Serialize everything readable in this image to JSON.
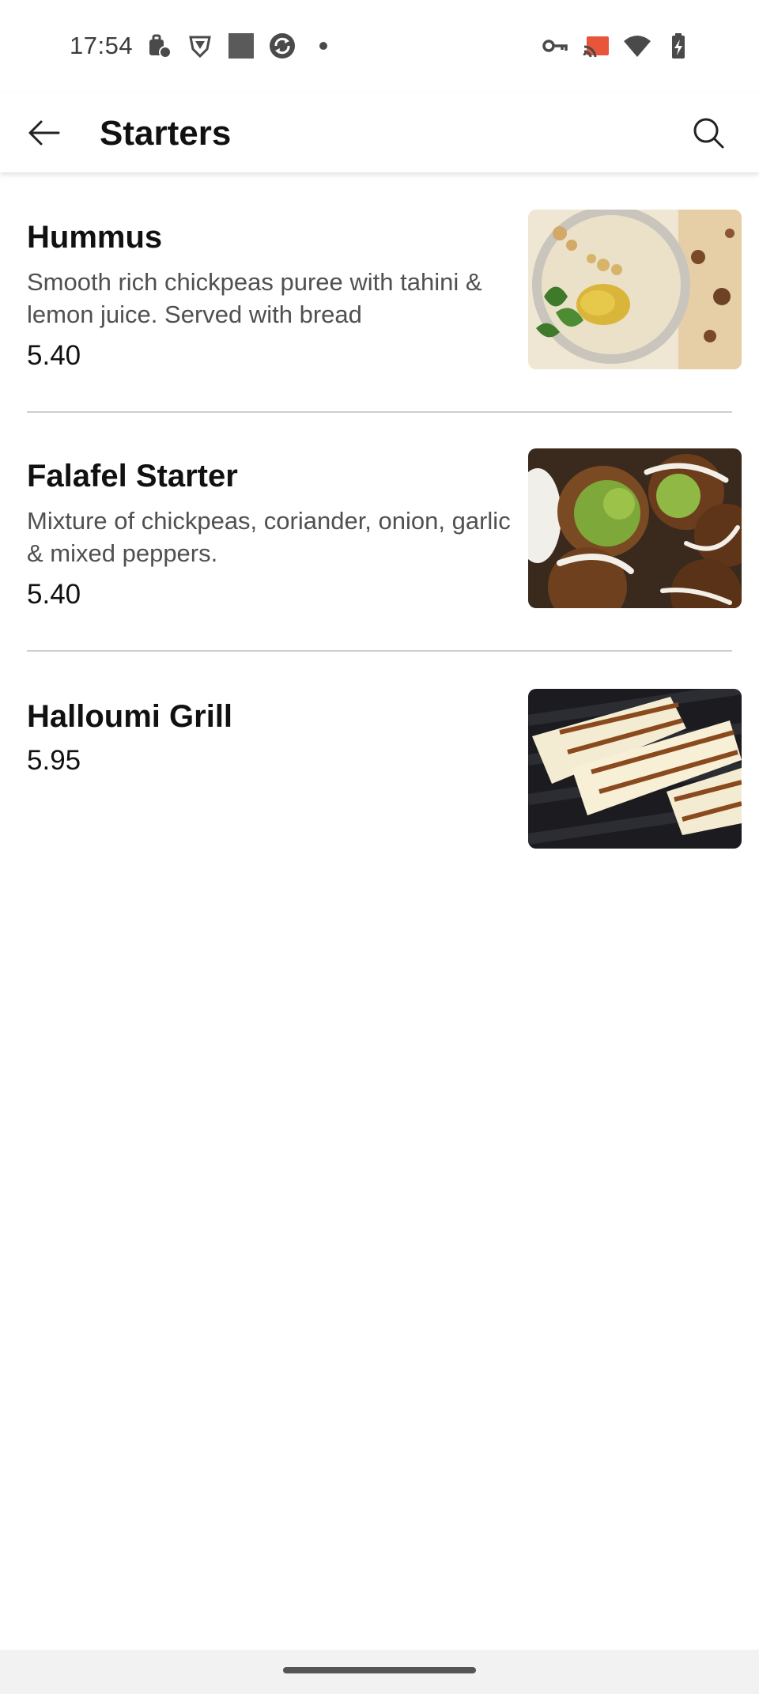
{
  "status_bar": {
    "time": "17:54",
    "left_icons": [
      "work-profile-icon",
      "vpn-shield-icon",
      "square-icon",
      "sync-icon",
      "dot-icon"
    ],
    "right_icons": [
      "key-icon",
      "cast-icon",
      "wifi-icon",
      "battery-charging-icon"
    ],
    "cast_accent": "#e8553a"
  },
  "app_bar": {
    "title": "Starters",
    "back_icon": "arrow-left-icon",
    "search_icon": "search-icon"
  },
  "menu": {
    "items": [
      {
        "name": "Hummus",
        "description": "Smooth rich chickpeas puree with tahini & lemon juice. Served with bread",
        "price": "5.40",
        "image": "hummus-photo"
      },
      {
        "name": "Falafel Starter",
        "description": "Mixture of chickpeas, coriander, onion, garlic & mixed peppers.",
        "price": "5.40",
        "image": "falafel-photo"
      },
      {
        "name": "Halloumi Grill",
        "description": "",
        "price": "5.95",
        "image": "halloumi-photo"
      }
    ]
  },
  "colors": {
    "text_primary": "#111111",
    "text_secondary": "#505050",
    "divider": "#cfcfcf",
    "nav_bar": "#f2f2f2"
  }
}
